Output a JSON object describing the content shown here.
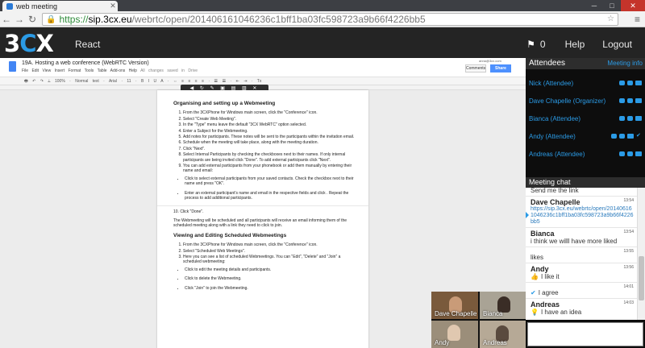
{
  "browser": {
    "tab_title": "web meeting",
    "url_scheme": "https://",
    "url_host": "sip.3cx.eu",
    "url_path": "/webrtc/open/201406161046236c1bff1ba03fc598723a9b66f4226bb5"
  },
  "app": {
    "logo_a": "3",
    "logo_b": "C",
    "logo_c": "X",
    "title": "React",
    "flag_count": "0",
    "help": "Help",
    "logout": "Logout"
  },
  "doc": {
    "title": "19A. Hosting a web conference (WebRTC Version)",
    "menu": "File Edit View Insert Format Tools Table Add-ons Help",
    "saved": "All changes saved in Drive",
    "user_email": "anna@3cx.com",
    "comments": "Comments",
    "share": "Share",
    "toolbar": "🖶 ↶ ↷ ⟂ 100% · Normal text · Arial · 11 · B I U A · ⇔ ≡ ≡ ≡ ≡ · ☰ ☰ · ⇤ ⇥ · Tx",
    "heading1": "Organising and setting up a Webmeeting",
    "steps1": [
      "From the 3CXPhone for Windows main screen, click the \"Conference\" icon.",
      "Select \"Create Web Meeting\".",
      "In the \"Type\" menu leave the default \"3CX WebRTC\" option selected.",
      "Enter a Subject for the Webmeeting.",
      "Add notes for participants. These notes will be sent to the participants within the invitation email.",
      "Schedule when the meeting will take place, along with the meeting duration.",
      "Click \"Next\".",
      "Select Internal Participants by checking the checkboxes next to their names. If only internal participants are being invited click \"Done\". To add external participants click \"Next\".",
      "You can add external participants from your phonebook or add them manually by entering their name and email:"
    ],
    "bullets1": [
      "Click    to select external participants from your saved contacts. Check the checkbox next to their name and press \"OK\".",
      "Enter an external participant's name and email in the respective fields and click    . Repeat the process to add additional participants."
    ],
    "step10": "10. Click \"Done\".",
    "para": "The Webmeeting will be scheduled and all participants will receive an email informing them of the scheduled meeting along with a link they need to click to join.",
    "heading2": "Viewing and Editing Scheduled Webmeetings",
    "steps2": [
      "From the 3CXPhone for Windows main screen, click the \"Conference\" icon.",
      "Select \"Scheduled Web Meetings\".",
      "Here you can see a list of scheduled Webmeetings. You can \"Edit\", \"Delete\" and \"Join\" a scheduled webmeeting:"
    ],
    "bullets2": [
      "Click    to edit the meeting details and participants.",
      "Click    to delete the Webmeeting.",
      "Click \"Join\" to join the Webmeeting."
    ]
  },
  "videos": [
    {
      "name": "Dave Chapelle"
    },
    {
      "name": "Bianca"
    },
    {
      "name": "Andy"
    },
    {
      "name": "Andreas"
    }
  ],
  "attendees": {
    "header": "Attendees",
    "meeting_info": "Meeting info",
    "list": [
      {
        "name": "Nick (Attendee)"
      },
      {
        "name": "Dave Chapelle (Organizer)"
      },
      {
        "name": "Bianca (Attendee)"
      },
      {
        "name": "Andy (Attendee)"
      },
      {
        "name": "Andreas (Attendee)"
      }
    ]
  },
  "chat": {
    "header": "Meeting chat",
    "top_line": "Send me the link",
    "messages": [
      {
        "author": "Dave Chapelle",
        "time": "13:54",
        "text": "https://sip.3cx.eu/webrtc/open/201406161046236c1bff1ba03fc598723a9b66f4226bb5"
      },
      {
        "author": "Bianca",
        "time": "13:54",
        "text": "i think we willl have more liked"
      },
      {
        "author": "",
        "time": "13:55",
        "text": "likes"
      },
      {
        "author": "Andy",
        "time": "13:56",
        "text": "I like it"
      },
      {
        "author": "",
        "time": "14:01",
        "text": "I agree"
      },
      {
        "author": "Andreas",
        "time": "14:03",
        "text": "I have an idea"
      }
    ]
  }
}
